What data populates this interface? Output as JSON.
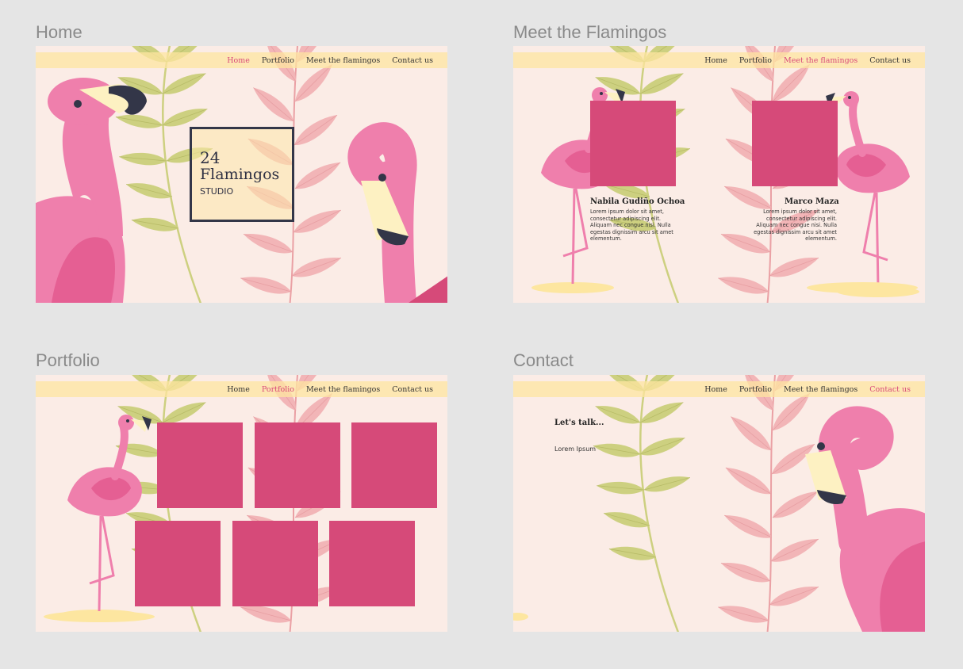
{
  "colors": {
    "canvas": "#e5e5e5",
    "page_bg": "#fbece6",
    "accent_pink": "#d64a79",
    "nav_bar": "#fde6a0",
    "leaf_green": "#cdd080",
    "leaf_pink": "#f2b5b7",
    "flamingo_pink": "#ef7fac",
    "dark": "#2f3144"
  },
  "nav": {
    "home": "Home",
    "portfolio": "Portfolio",
    "meet": "Meet the flamingos",
    "contact": "Contact us"
  },
  "frames": {
    "home": {
      "label": "Home",
      "title_number": "24",
      "title_name": "Flamingos",
      "title_sub": "STUDIO"
    },
    "meet": {
      "label": "Meet the Flamingos",
      "people": [
        {
          "name": "Nabila Gudiño Ochoa",
          "bio": "Lorem ipsum dolor sit amet, consectetur adipiscing elit. Aliquam nec congue nisi. Nulla egestas dignissim arcu sit amet elementum."
        },
        {
          "name": "Marco Maza",
          "bio": "Lorem ipsum dolor sit amet, consectetur adipiscing elit. Aliquam nec congue nisi. Nulla egestas dignissim arcu sit amet elementum."
        }
      ]
    },
    "portfolio": {
      "label": "Portfolio"
    },
    "contact": {
      "label": "Contact",
      "heading": "Let's talk...",
      "text": "Lorem Ipsum"
    }
  }
}
